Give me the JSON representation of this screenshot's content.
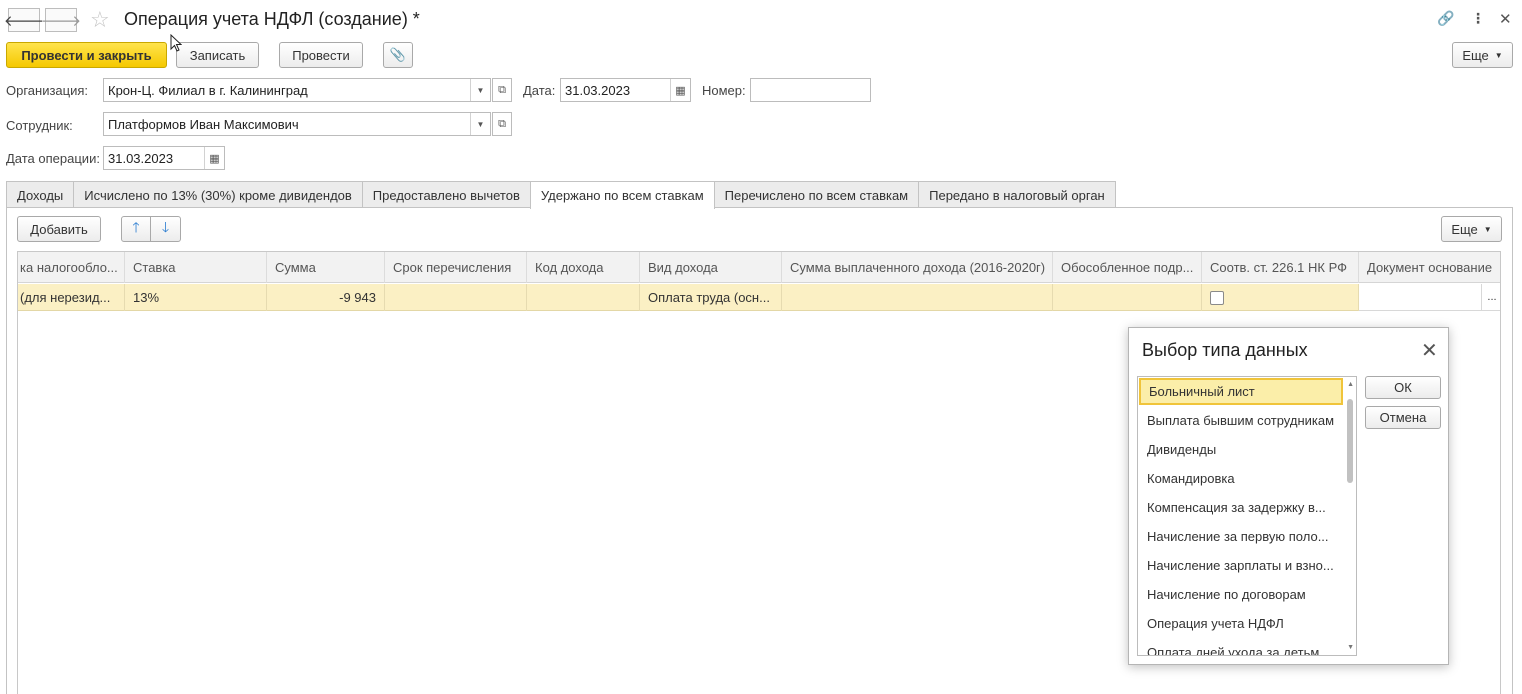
{
  "window": {
    "title": "Операция учета НДФЛ (создание) *"
  },
  "nav": {
    "back_icon": "arrow-left-icon",
    "forward_icon": "arrow-right-icon",
    "favorite_icon": "star-icon"
  },
  "toolbar": {
    "post_close_label": "Провести и закрыть",
    "save_label": "Записать",
    "post_label": "Провести",
    "more_label": "Еще"
  },
  "form": {
    "org_label": "Организация:",
    "org_value": "Крон-Ц. Филиал в г. Калининград",
    "date_label": "Дата:",
    "date_value": "31.03.2023",
    "number_label": "Номер:",
    "number_value": "",
    "employee_label": "Сотрудник:",
    "employee_value": "Платформов Иван Максимович",
    "op_date_label": "Дата операции:",
    "op_date_value": "31.03.2023"
  },
  "tabs": [
    {
      "label": "Доходы"
    },
    {
      "label": "Исчислено по 13% (30%) кроме дивидендов"
    },
    {
      "label": "Предоставлено вычетов"
    },
    {
      "label": "Удержано по всем ставкам"
    },
    {
      "label": "Перечислено по всем ставкам"
    },
    {
      "label": "Передано в налоговый орган"
    }
  ],
  "active_tab": "Удержано по всем ставкам",
  "panel_toolbar": {
    "add_label": "Добавить",
    "more_label": "Еще"
  },
  "table": {
    "columns": [
      "ка налогообло...",
      "Ставка",
      "Сумма",
      "Срок перечисления",
      "Код дохода",
      "Вид дохода",
      "Сумма выплаченного дохода (2016-2020г)",
      "Обособленное подр...",
      "Соотв. ст. 226.1 НК РФ",
      "Документ основание"
    ],
    "rows": [
      {
        "c0": "(для нерезид...",
        "c1": "13%",
        "c2": "-9 943",
        "c3": "",
        "c4": "",
        "c5": "Оплата труда (осн...",
        "c6": "",
        "c7": "",
        "c8_checked": false,
        "c9": "",
        "c9_btn": "..."
      }
    ]
  },
  "dialog": {
    "title": "Выбор типа данных",
    "ok_label": "ОК",
    "cancel_label": "Отмена",
    "items": [
      "Больничный лист",
      "Выплата бывшим сотрудникам",
      "Дивиденды",
      "Командировка",
      "Компенсация за задержку в...",
      "Начисление за первую поло...",
      "Начисление зарплаты и взно...",
      "Начисление по договорам",
      "Операция учета НДФЛ",
      "Оплата дней ухода за детьм..."
    ],
    "selected": "Больничный лист"
  }
}
